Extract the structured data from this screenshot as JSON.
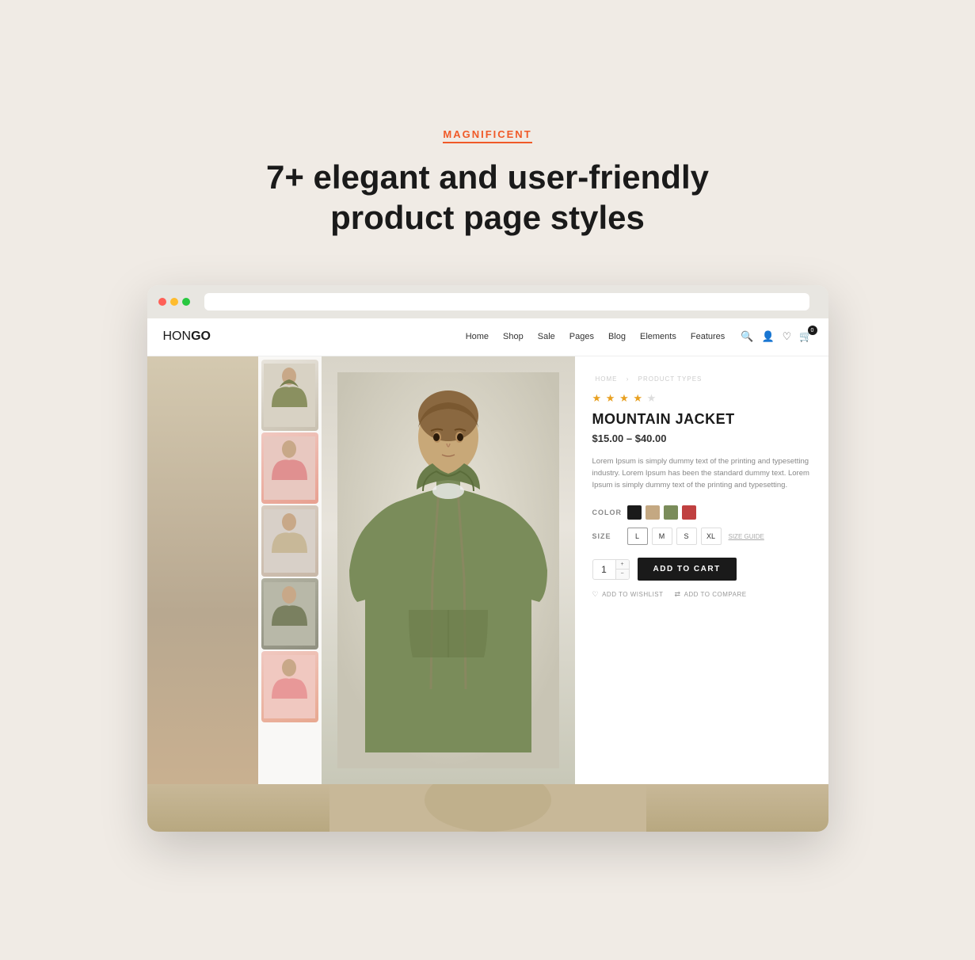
{
  "page": {
    "background_color": "#f0ebe5"
  },
  "header": {
    "badge": "MAGNIFICENT",
    "headline_line1": "7+ elegant and user-friendly",
    "headline_line2": "product page styles"
  },
  "navbar": {
    "logo": "HON",
    "logo_bold": "GO",
    "nav_items": [
      "Home",
      "Shop",
      "Sale",
      "Pages",
      "Blog",
      "Elements",
      "Features"
    ],
    "cart_count": "0"
  },
  "product": {
    "breadcrumb_home": "HOME",
    "breadcrumb_sep": "›",
    "breadcrumb_current": "PRODUCT TYPES",
    "stars_filled": 4,
    "stars_total": 5,
    "title": "MOUNTAIN JACKET",
    "price": "$15.00 – $40.00",
    "description": "Lorem Ipsum is simply dummy text of the printing and typesetting industry. Lorem Ipsum has been the standard dummy text. Lorem Ipsum is simply dummy text of the printing and typesetting.",
    "color_label": "COLOR",
    "colors": [
      "black",
      "tan",
      "olive",
      "red"
    ],
    "size_label": "SIZE",
    "sizes": [
      "L",
      "M",
      "S",
      "XL"
    ],
    "size_guide_label": "SIZE GUIDE",
    "quantity": "1",
    "add_to_cart_label": "ADD TO CART",
    "wishlist_label": "ADD TO WISHLIST",
    "compare_label": "ADD TO COMPARE"
  }
}
